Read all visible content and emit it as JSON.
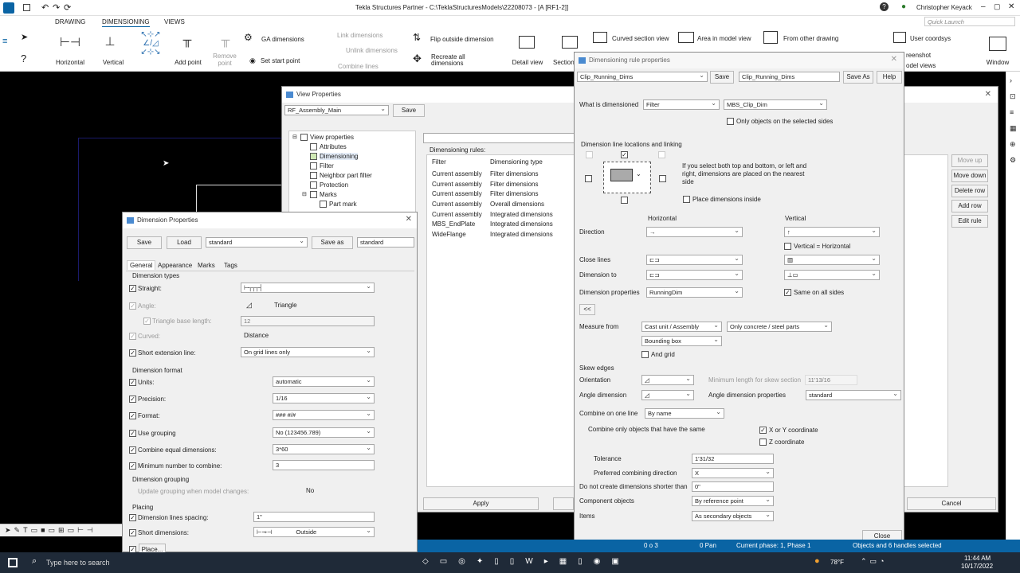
{
  "titlebar": {
    "title": "Tekla Structures Partner - C:\\TeklaStructuresModels\\22208073 - [A  [RF1-2]]",
    "user": "Christopher Keyack",
    "quick_launch": "Quick Launch"
  },
  "menu": {
    "tabs": [
      "DRAWING",
      "DIMENSIONING",
      "VIEWS"
    ]
  },
  "ribbon": {
    "horizontal": "Horizontal",
    "vertical": "Vertical",
    "add_point": "Add point",
    "remove_point": "Remove point",
    "ga_dimensions": "GA dimensions",
    "set_start_point": "Set start point",
    "link_dimensions": "Link dimensions",
    "unlink_dimensions": "Unlink dimensions",
    "combine_lines": "Combine lines",
    "flip_outside": "Flip outside dimension",
    "recreate_all": "Recreate all dimensions",
    "detail_view": "Detail view",
    "section": "Section",
    "curved_section": "Curved section view",
    "area_model": "Area in model view",
    "from_other": "From other drawing",
    "user_coordsys": "User coordsys",
    "screenshot": "reenshot",
    "model_views": "odel views",
    "window": "Window"
  },
  "view_props": {
    "title": "View Properties",
    "preset": "RF_Assembly_Main",
    "save": "Save",
    "tree": [
      "View properties",
      "Attributes",
      "Dimensioning",
      "Filter",
      "Neighbor part filter",
      "Protection",
      "Marks",
      "Part mark"
    ],
    "rules_label": "Dimensioning rules:",
    "col_filter": "Filter",
    "col_type": "Dimensioning type",
    "rows": [
      [
        "Current assembly",
        "Filter dimensions"
      ],
      [
        "Current assembly",
        "Filter dimensions"
      ],
      [
        "Current assembly",
        "Filter dimensions"
      ],
      [
        "Current assembly",
        "Overall dimensions"
      ],
      [
        "Current assembly",
        "Integrated dimensions"
      ],
      [
        "MBS_EndPlate",
        "Integrated dimensions"
      ],
      [
        "WideFlange",
        "Integrated dimensions"
      ]
    ],
    "move_up": "Move up",
    "move_down": "Move down",
    "delete_row": "Delete row",
    "add_row": "Add row",
    "edit_rule": "Edit rule",
    "apply": "Apply",
    "cancel": "Cancel"
  },
  "dim_props": {
    "title": "Dimension Properties",
    "save": "Save",
    "load": "Load",
    "preset": "standard",
    "save_as": "Save as",
    "save_as_value": "standard",
    "tabs": [
      "General",
      "Appearance",
      "Marks",
      "Tags"
    ],
    "sec_types": "Dimension types",
    "straight": "Straight:",
    "angle": "Angle:",
    "angle_val": "Triangle",
    "tri_base": "Triangle base length:",
    "tri_val": "12",
    "curved": "Curved:",
    "curved_val": "Distance",
    "short_ext": "Short extension line:",
    "short_ext_val": "On grid lines only",
    "sec_format": "Dimension format",
    "units": "Units:",
    "units_val": "automatic",
    "precision": "Precision:",
    "precision_val": "1/16",
    "format": "Format:",
    "format_val": "### #/#",
    "use_grouping": "Use grouping",
    "use_grouping_val": "No (123456.789)",
    "combine_equal": "Combine equal dimensions:",
    "combine_equal_val": "3*60",
    "min_combine": "Minimum number to combine:",
    "min_combine_val": "3",
    "sec_grouping": "Dimension grouping",
    "update_grouping": "Update grouping when model changes:",
    "update_grouping_val": "No",
    "sec_placing": "Placing",
    "lines_spacing": "Dimension lines spacing:",
    "lines_spacing_val": "1\"",
    "short_dims": "Short dimensions:",
    "short_dims_val": "Outside",
    "place": "Place..."
  },
  "rule_props": {
    "title": "Dimensioning rule properties",
    "preset": "Clip_Running_Dims",
    "save": "Save",
    "name": "Clip_Running_Dims",
    "save_as": "Save As",
    "help": "Help",
    "what_dimensioned": "What is dimensioned",
    "what_val": "Filter",
    "filter_val": "MBS_Clip_Dim",
    "only_selected": "Only objects on the selected sides",
    "line_loc": "Dimension line locations and linking",
    "line_note": "If you select both top and bottom, or left and right, dimensions are placed on the nearest side",
    "place_inside": "Place dimensions inside",
    "horizontal": "Horizontal",
    "vertical": "Vertical",
    "direction": "Direction",
    "dir_h": "→",
    "dir_v": "↑",
    "vert_eq_horiz": "Vertical = Horizontal",
    "close_lines": "Close lines",
    "dim_to": "Dimension to",
    "dim_props": "Dimension properties",
    "dim_props_val": "RunningDim",
    "same_all": "Same on all sides",
    "collapse": "<<",
    "measure_from": "Measure from",
    "measure_val": "Cast unit / Assembly",
    "only_concrete": "Only concrete / steel parts",
    "bounding_box": "Bounding box",
    "and_grid": "And grid",
    "skew_edges": "Skew edges",
    "orientation": "Orientation",
    "min_len_skew": "Minimum length for skew section",
    "min_len_val": "11'13/16",
    "angle_dim": "Angle dimension",
    "angle_dim_props": "Angle dimension properties",
    "angle_props_val": "standard",
    "combine_one": "Combine on one line",
    "combine_val": "By name",
    "combine_only": "Combine only objects that have the same",
    "xy_coord": "X or Y coordinate",
    "z_coord": "Z coordinate",
    "tolerance": "Tolerance",
    "tolerance_val": "1'31/32",
    "pref_dir": "Preferred combining direction",
    "pref_dir_val": "X",
    "no_shorter": "Do not create dimensions shorter than",
    "no_shorter_val": "0\"",
    "component_objects": "Component objects",
    "component_val": "By reference point",
    "items": "Items",
    "items_val": "As secondary objects",
    "close": "Close"
  },
  "status": {
    "text1": "0 o 3",
    "text2": "0 Pan",
    "text3": "Current phase: 1, Phase 1",
    "text4": "Objects and 6 handles selected"
  },
  "taskbar": {
    "search": "Type here to search",
    "weather": "78°F",
    "time": "11:44 AM",
    "date": "10/17/2022"
  },
  "colors": {
    "accent": "#0a64a4",
    "titlebar": "#ffffff",
    "drawing_bg": "#000000"
  }
}
